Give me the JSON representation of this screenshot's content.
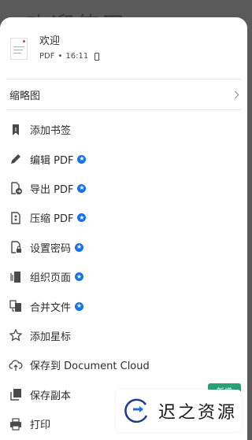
{
  "background_title": "欢迎使用",
  "file": {
    "name": "欢迎",
    "type": "PDF",
    "separator": "•",
    "time": "16:11"
  },
  "thumbnail_row": {
    "label": "缩略图"
  },
  "menu": [
    {
      "label": "添加书签",
      "icon": "bookmark-icon",
      "premium": false
    },
    {
      "label": "编辑 PDF",
      "icon": "pencil-icon",
      "premium": true
    },
    {
      "label": "导出 PDF",
      "icon": "export-pdf-icon",
      "premium": true
    },
    {
      "label": "压缩 PDF",
      "icon": "compress-pdf-icon",
      "premium": true
    },
    {
      "label": "设置密码",
      "icon": "lock-file-icon",
      "premium": true
    },
    {
      "label": "组织页面",
      "icon": "organize-pages-icon",
      "premium": true
    },
    {
      "label": "合并文件",
      "icon": "combine-files-icon",
      "premium": true
    },
    {
      "label": "添加星标",
      "icon": "star-icon",
      "premium": false
    },
    {
      "label": "保存到 Document Cloud",
      "icon": "cloud-upload-icon",
      "premium": false
    },
    {
      "label": "保存副本",
      "icon": "copy-icon",
      "premium": false
    },
    {
      "label": "打印",
      "icon": "printer-icon",
      "premium": false
    }
  ],
  "new_badge": "新增",
  "watermark": {
    "text": "迟之资源"
  },
  "colors": {
    "premium_blue": "#1473e6",
    "badge_green": "#2d9d78",
    "text": "#2c2c2c"
  }
}
